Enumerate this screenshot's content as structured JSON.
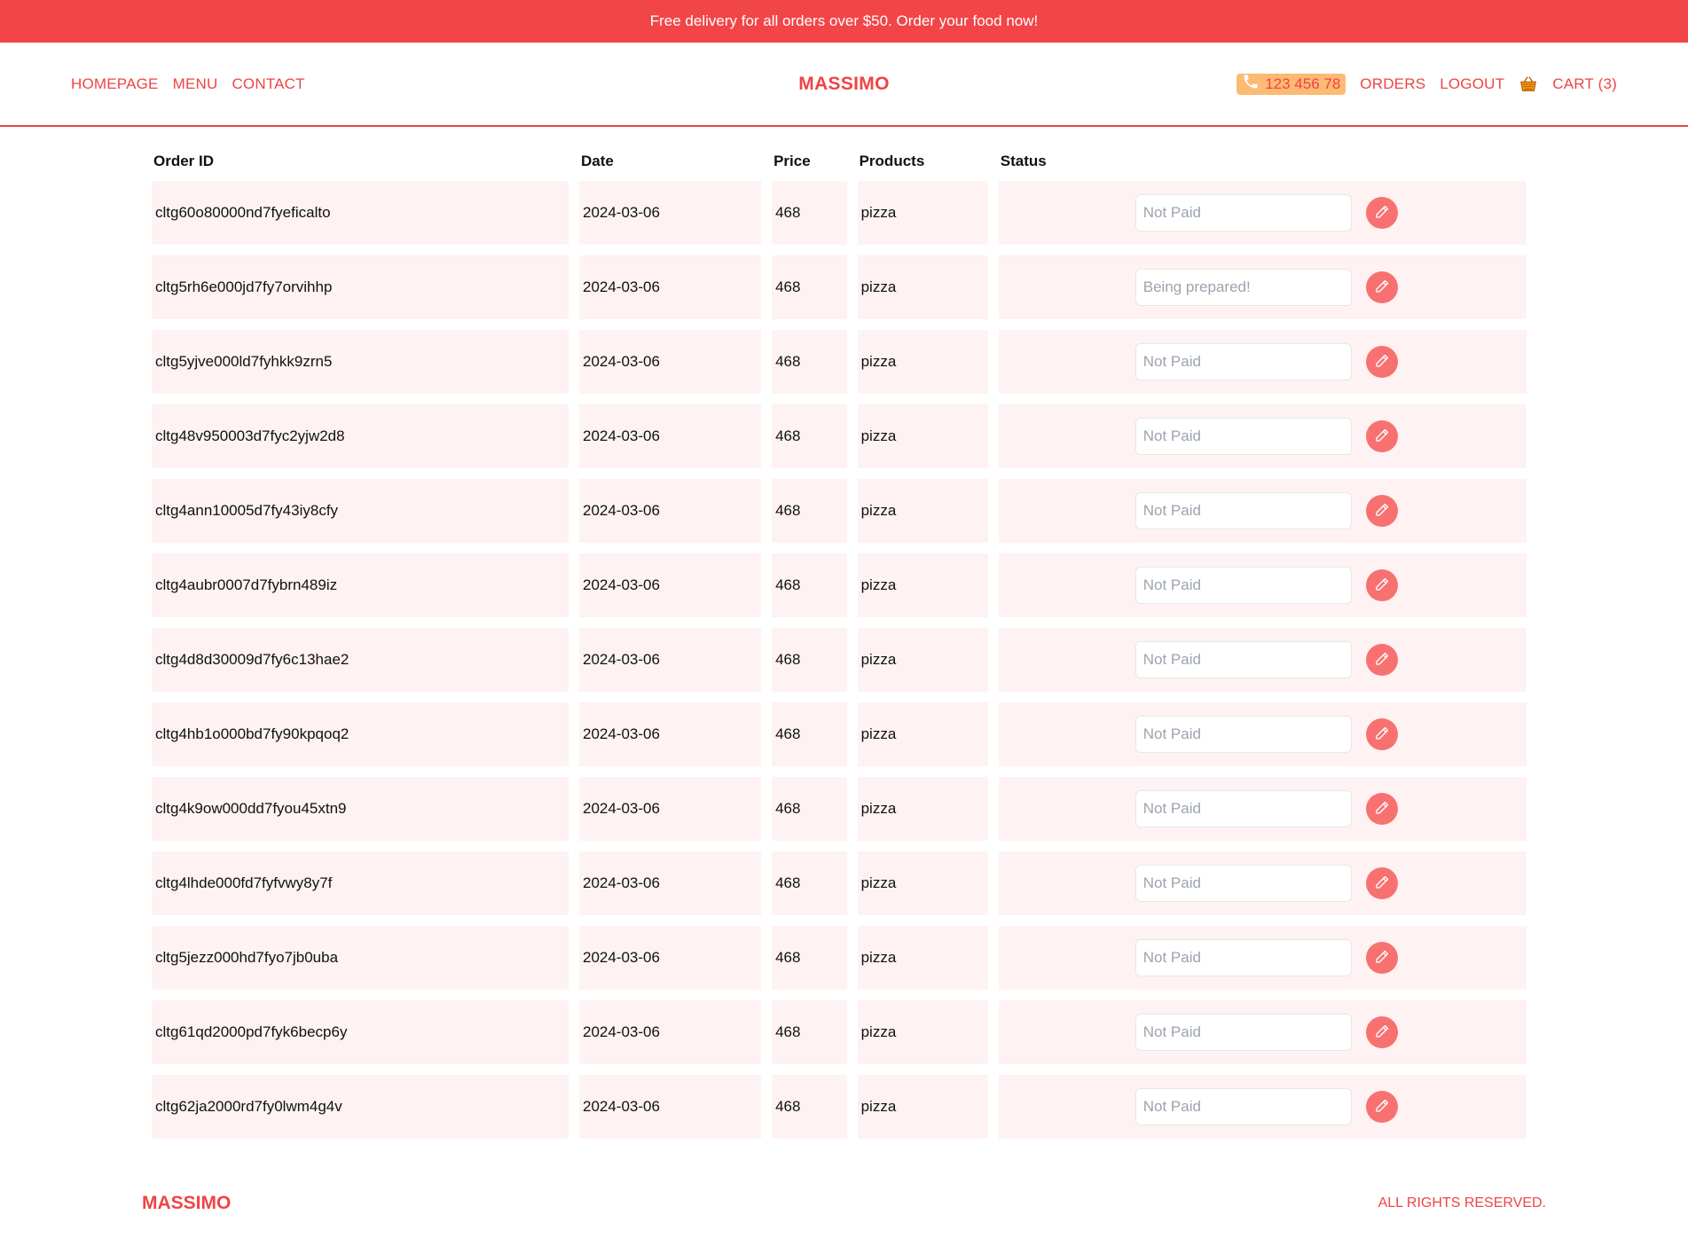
{
  "promo": {
    "text": "Free delivery for all orders over $50. Order your food now!"
  },
  "header": {
    "nav_left": [
      {
        "label": "HOMEPAGE"
      },
      {
        "label": "MENU"
      },
      {
        "label": "CONTACT"
      }
    ],
    "brand": "MASSIMO",
    "phone": "123 456 78",
    "nav_right": {
      "orders": "ORDERS",
      "logout": "LOGOUT",
      "cart": "CART (3)"
    }
  },
  "table": {
    "headers": {
      "id": "Order ID",
      "date": "Date",
      "price": "Price",
      "products": "Products",
      "status": "Status"
    },
    "rows": [
      {
        "id": "cltg60o80000nd7fyeficalto",
        "date": "2024-03-06",
        "price": "468",
        "products": "pizza",
        "status": "Not Paid"
      },
      {
        "id": "cltg5rh6e000jd7fy7orvihhp",
        "date": "2024-03-06",
        "price": "468",
        "products": "pizza",
        "status": "Being prepared!"
      },
      {
        "id": "cltg5yjve000ld7fyhkk9zrn5",
        "date": "2024-03-06",
        "price": "468",
        "products": "pizza",
        "status": "Not Paid"
      },
      {
        "id": "cltg48v950003d7fyc2yjw2d8",
        "date": "2024-03-06",
        "price": "468",
        "products": "pizza",
        "status": "Not Paid"
      },
      {
        "id": "cltg4ann10005d7fy43iy8cfy",
        "date": "2024-03-06",
        "price": "468",
        "products": "pizza",
        "status": "Not Paid"
      },
      {
        "id": "cltg4aubr0007d7fybrn489iz",
        "date": "2024-03-06",
        "price": "468",
        "products": "pizza",
        "status": "Not Paid"
      },
      {
        "id": "cltg4d8d30009d7fy6c13hae2",
        "date": "2024-03-06",
        "price": "468",
        "products": "pizza",
        "status": "Not Paid"
      },
      {
        "id": "cltg4hb1o000bd7fy90kpqoq2",
        "date": "2024-03-06",
        "price": "468",
        "products": "pizza",
        "status": "Not Paid"
      },
      {
        "id": "cltg4k9ow000dd7fyou45xtn9",
        "date": "2024-03-06",
        "price": "468",
        "products": "pizza",
        "status": "Not Paid"
      },
      {
        "id": "cltg4lhde000fd7fyfvwy8y7f",
        "date": "2024-03-06",
        "price": "468",
        "products": "pizza",
        "status": "Not Paid"
      },
      {
        "id": "cltg5jezz000hd7fyo7jb0uba",
        "date": "2024-03-06",
        "price": "468",
        "products": "pizza",
        "status": "Not Paid"
      },
      {
        "id": "cltg61qd2000pd7fyk6becp6y",
        "date": "2024-03-06",
        "price": "468",
        "products": "pizza",
        "status": "Not Paid"
      },
      {
        "id": "cltg62ja2000rd7fy0lwm4g4v",
        "date": "2024-03-06",
        "price": "468",
        "products": "pizza",
        "status": "Not Paid"
      }
    ]
  },
  "footer": {
    "brand": "MASSIMO",
    "rights": "ALL RIGHTS RESERVED."
  },
  "icons": {
    "phone": "phone-icon",
    "cart": "basket-icon",
    "edit": "pencil-icon"
  },
  "colors": {
    "accent": "#ef4444",
    "row_bg": "#fef2f2",
    "phone_bg": "#fdba74",
    "edit_btn": "#f87171"
  }
}
